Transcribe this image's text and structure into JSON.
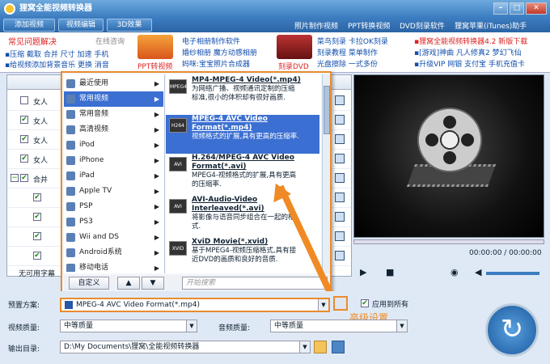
{
  "app": {
    "title": "狸窝全能视频转换器"
  },
  "toolbar": {
    "buttons": [
      "添加视频",
      "视频编辑",
      "3D效果"
    ],
    "links": [
      "照片制作视频",
      "PPT转换视频",
      "DVD刻录软件",
      "狸窝苹果(iTunes)助手"
    ]
  },
  "ads": {
    "faq": "常见问题解决",
    "online": "在线咨询",
    "faq_links1": "▪压缩 截取 合并 尺寸 加速 手机",
    "faq_links2": "▪给视频添加背景音乐 更换 消音",
    "ppt": "PPT转视频",
    "ecard": "电子相册制作软件",
    "ecard2": "婚纱相册  魔方动感相册",
    "ecard3": "妈咪:宝宝照片合成器",
    "dvd": "刻录DVD",
    "dvd1": "菜鸟刻录 卡拉OK刻录",
    "dvd2": "刻录教程 菜单制作",
    "dvd3": "光盘擦除 一式多份",
    "right1": "▪狸窝全能视频转换器4.2 新版下载",
    "right2": "▪[游戏]神曲 凡人修真2 梦幻飞仙",
    "right3": "▪升级VIP 网银 支付宝 手机充值卡"
  },
  "files": {
    "rows": [
      "女人",
      "女人",
      "女人",
      "女人",
      "合并",
      "",
      "",
      "",
      "",
      ""
    ],
    "subtitle": "无可用字幕"
  },
  "menu": {
    "left": [
      {
        "label": "最近使用"
      },
      {
        "label": "常用视频"
      },
      {
        "label": "常用音频"
      },
      {
        "label": "高清视频"
      },
      {
        "label": "iPod"
      },
      {
        "label": "iPhone"
      },
      {
        "label": "iPad"
      },
      {
        "label": "Apple TV"
      },
      {
        "label": "PSP"
      },
      {
        "label": "PS3"
      },
      {
        "label": "Wii and DS"
      },
      {
        "label": "Android系统"
      },
      {
        "label": "移动电话"
      }
    ],
    "formats": [
      {
        "badge": "MPEG4",
        "title": "MP4-MPEG-4 Video(*.mp4)",
        "desc1": "为网络广播、视频通讯定制的压缩",
        "desc2": "标准,很小的体积却有很好画质."
      },
      {
        "badge": "H264",
        "title": "MPEG-4 AVC Video",
        "title2": "Format(*.mp4)",
        "desc1": "视频格式的扩展,具有更高的压缩率."
      },
      {
        "badge": "AVI",
        "title": "H.264/MPEG-4 AVC Video",
        "title2": "Format(*.avi)",
        "desc1": "MPEG4-视频格式的扩展,具有更高",
        "desc2": "的压缩率."
      },
      {
        "badge": "AVI",
        "title": "AVI-Audio-Video",
        "title2": "Interleaved(*.avi)",
        "desc1": "将影像与语音同步组合在一起的格",
        "desc2": "式."
      },
      {
        "badge": "XVID",
        "title": "XviD Movie(*.xvid)",
        "desc1": "基于MPEG4-视频压缩格式,具有接",
        "desc2": "近DVD的画质和良好的音质."
      }
    ],
    "customize": "自定义",
    "search_placeholder": "开始搜索"
  },
  "player": {
    "time": "00:00:00 / 00:00:00"
  },
  "bottom": {
    "preset_label": "预置方案:",
    "preset_value": "MPEG-4 AVC Video Format(*.mp4)",
    "apply_all": "应用到所有",
    "advanced": "高级设置",
    "video_quality_label": "视频质量:",
    "video_quality": "中等质量",
    "audio_quality_label": "音频质量:",
    "audio_quality": "中等质量",
    "output_label": "输出目录:",
    "output_path": "D:\\My Documents\\狸窝\\全能视频转换器"
  }
}
